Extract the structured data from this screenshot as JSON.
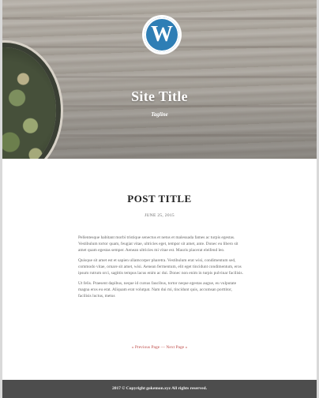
{
  "header": {
    "site_title": "Site Title",
    "tagline": "Tagline",
    "logo_icon": "wordpress-logo-icon",
    "logo_glyph": "W",
    "brand_color": "#2e7eb5"
  },
  "post": {
    "title": "POST TITLE",
    "date": "JUNE 25, 2015",
    "paragraphs": [
      "Pellentesque habitant morbi tristique senectus et netus et malesuada fames ac turpis egestas. Vestibulum tortor quam, feugiat vitae, ultricies eget, tempor sit amet, ante. Donec eu libero sit amet quam egestas semper. Aenean ultricies mi vitae est. Mauris placerat eleifend leo.",
      "Quisque sit amet est et sapien ullamcorper pharetra. Vestibulum erat wisi, condimentum sed, commodo vitae, ornare sit amet, wisi. Aenean fermentum, elit eget tincidunt condimentum, eros ipsum rutrum orci, sagittis tempus lacus enim ac dui. Donec non enim in turpis pulvinar facilisis.",
      "Ut felis. Praesent dapibus, neque id cursus faucibus, tortor neque egestas augue, eu vulputate magna eros eu erat. Aliquam erat volutpat. Nam dui mi, tincidunt quis, accumsan porttitor, facilisis luctus, metus"
    ]
  },
  "pager": {
    "previous_label": "« Previous Page",
    "separator": "—",
    "next_label": "Next Page »",
    "link_color": "#c0504d"
  },
  "footer": {
    "copyright": "2017 © Copyright gokemon.xyz All rights reserved."
  }
}
